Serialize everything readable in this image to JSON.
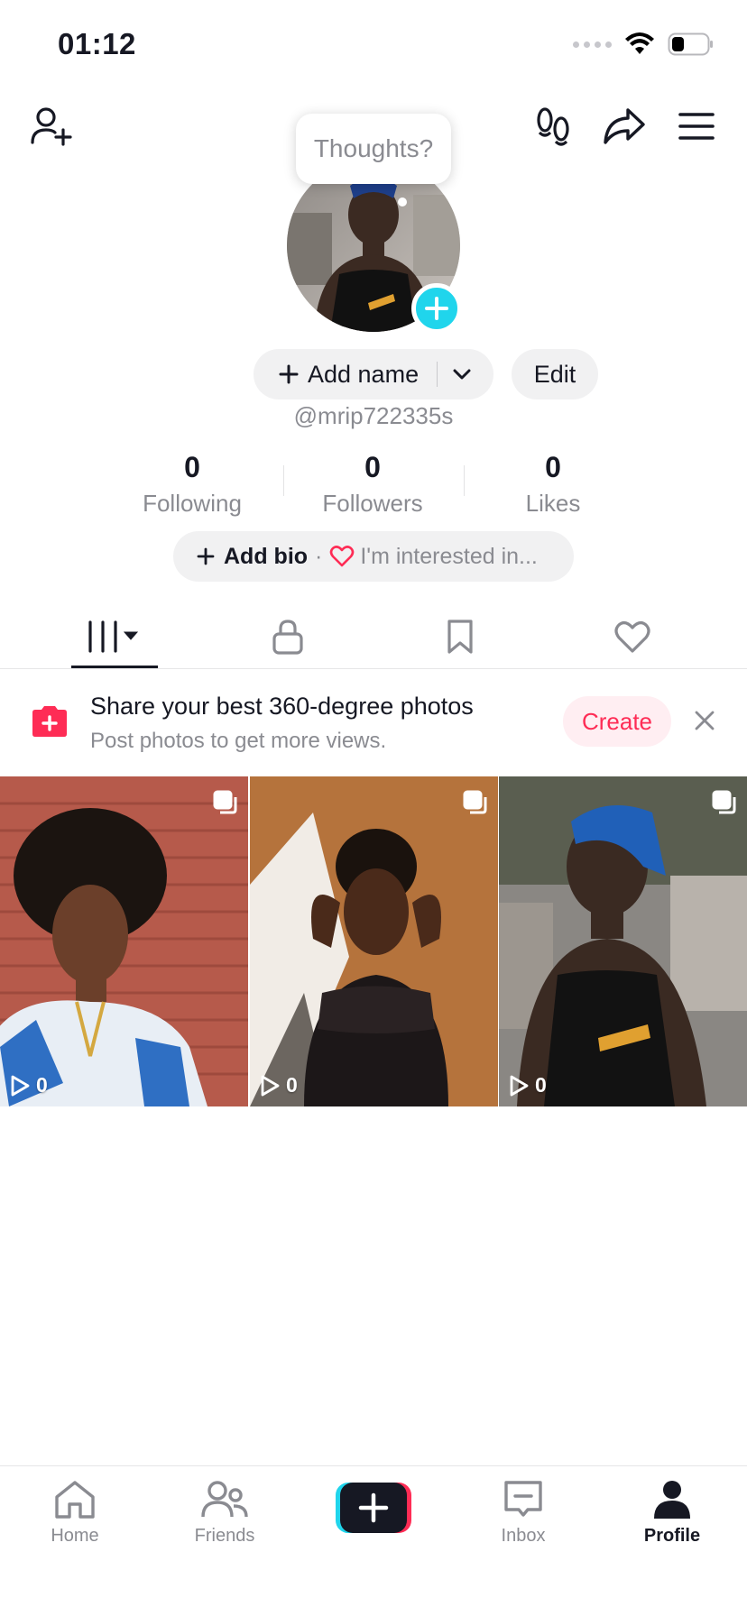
{
  "status_bar": {
    "time": "01:12"
  },
  "tooltip": {
    "text": "Thoughts?"
  },
  "profile": {
    "add_name_label": "Add name",
    "edit_label": "Edit",
    "username": "@mrip722335s"
  },
  "stats": [
    {
      "value": "0",
      "label": "Following"
    },
    {
      "value": "0",
      "label": "Followers"
    },
    {
      "value": "0",
      "label": "Likes"
    }
  ],
  "bio": {
    "add_bio_label": "Add bio",
    "separator": "·",
    "interest_label": "I'm interested in..."
  },
  "tabs": [
    {
      "icon": "videos-grid-icon",
      "active": true
    },
    {
      "icon": "lock-icon",
      "active": false
    },
    {
      "icon": "bookmark-icon",
      "active": false
    },
    {
      "icon": "heart-icon",
      "active": false
    }
  ],
  "banner": {
    "title": "Share your best 360-degree photos",
    "subtitle": "Post photos to get more views.",
    "create_label": "Create"
  },
  "posts": [
    {
      "views": "0"
    },
    {
      "views": "0"
    },
    {
      "views": "0"
    }
  ],
  "bottom_nav": [
    {
      "label": "Home",
      "icon": "home-icon",
      "active": false
    },
    {
      "label": "Friends",
      "icon": "friends-icon",
      "active": false
    },
    {
      "label": "",
      "icon": "create-plus-icon",
      "active": false
    },
    {
      "label": "Inbox",
      "icon": "inbox-icon",
      "active": false
    },
    {
      "label": "Profile",
      "icon": "profile-icon",
      "active": true
    }
  ],
  "colors": {
    "accent": "#fe2c55",
    "cyan": "#20d5ec",
    "text": "#161823",
    "muted": "#8a8b91"
  }
}
